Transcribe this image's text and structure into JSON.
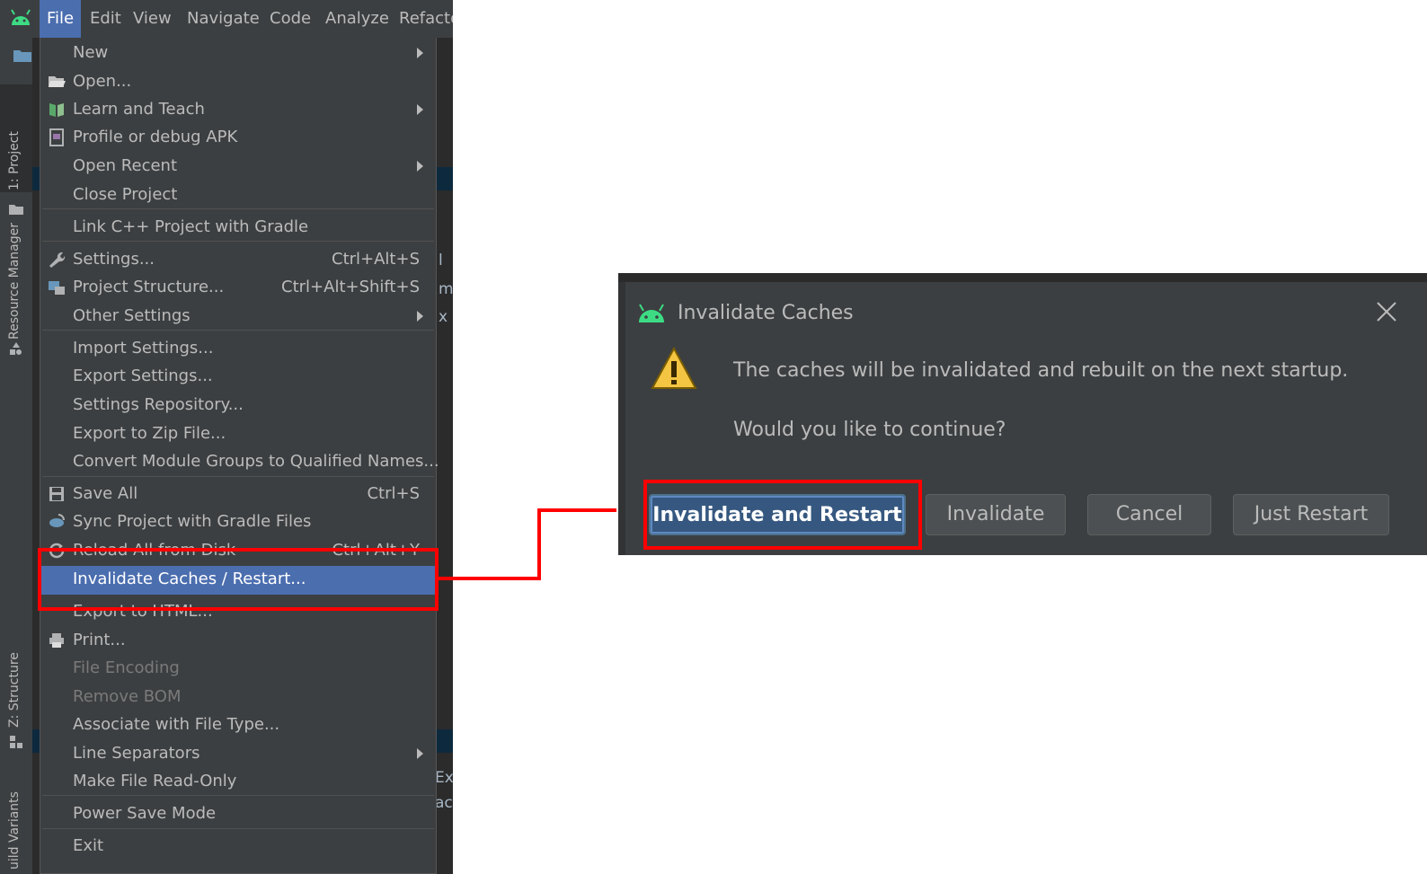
{
  "menubar": {
    "items": [
      "File",
      "Edit",
      "View",
      "Navigate",
      "Code",
      "Analyze",
      "Refacto"
    ],
    "active_index": 0
  },
  "tool_strip": {
    "tabs": [
      "1: Project",
      "Resource Manager",
      "Z: Structure",
      "uild Variants"
    ]
  },
  "editor_peek": [
    "l",
    "m",
    "x",
    "Ex",
    "ac"
  ],
  "file_menu": {
    "items": [
      {
        "label": "New",
        "submenu": true
      },
      {
        "label": "Open...",
        "icon": "folder-open-icon"
      },
      {
        "label": "Learn and Teach",
        "icon": "book-icon",
        "submenu": true
      },
      {
        "label": "Profile or debug APK",
        "icon": "apk-icon"
      },
      {
        "label": "Open Recent",
        "submenu": true
      },
      {
        "label": "Close Project"
      },
      {
        "label": "Link C++ Project with Gradle"
      },
      {
        "label": "Settings...",
        "icon": "wrench-icon",
        "shortcut": "Ctrl+Alt+S"
      },
      {
        "label": "Project Structure...",
        "icon": "project-structure-icon",
        "shortcut": "Ctrl+Alt+Shift+S"
      },
      {
        "label": "Other Settings",
        "submenu": true
      },
      {
        "label": "Import Settings..."
      },
      {
        "label": "Export Settings..."
      },
      {
        "label": "Settings Repository..."
      },
      {
        "label": "Export to Zip File..."
      },
      {
        "label": "Convert Module Groups to Qualified Names..."
      },
      {
        "label": "Save All",
        "icon": "save-icon",
        "shortcut": "Ctrl+S"
      },
      {
        "label": "Sync Project with Gradle Files",
        "icon": "gradle-sync-icon"
      },
      {
        "label": "Reload All from Disk",
        "icon": "reload-icon",
        "shortcut": "Ctrl+Alt+Y"
      },
      {
        "label": "Invalidate Caches / Restart...",
        "highlighted": true
      },
      {
        "label": "Export to HTML..."
      },
      {
        "label": "Print...",
        "icon": "printer-icon"
      },
      {
        "label": "File Encoding",
        "disabled": true
      },
      {
        "label": "Remove BOM",
        "disabled": true
      },
      {
        "label": "Associate with File Type..."
      },
      {
        "label": "Line Separators",
        "submenu": true
      },
      {
        "label": "Make File Read-Only"
      },
      {
        "label": "Power Save Mode"
      },
      {
        "label": "Exit"
      }
    ]
  },
  "dialog": {
    "title": "Invalidate Caches",
    "message": "The caches will be invalidated and rebuilt on the next startup.",
    "question": "Would you like to continue?",
    "buttons": {
      "invalidate_restart": "Invalidate and Restart",
      "invalidate": "Invalidate",
      "cancel": "Cancel",
      "just_restart": "Just Restart"
    }
  },
  "colors": {
    "menu_bg": "#3c3f41",
    "highlight": "#4b6eaf",
    "callout": "#ff0000",
    "android_green": "#3ddc84"
  }
}
